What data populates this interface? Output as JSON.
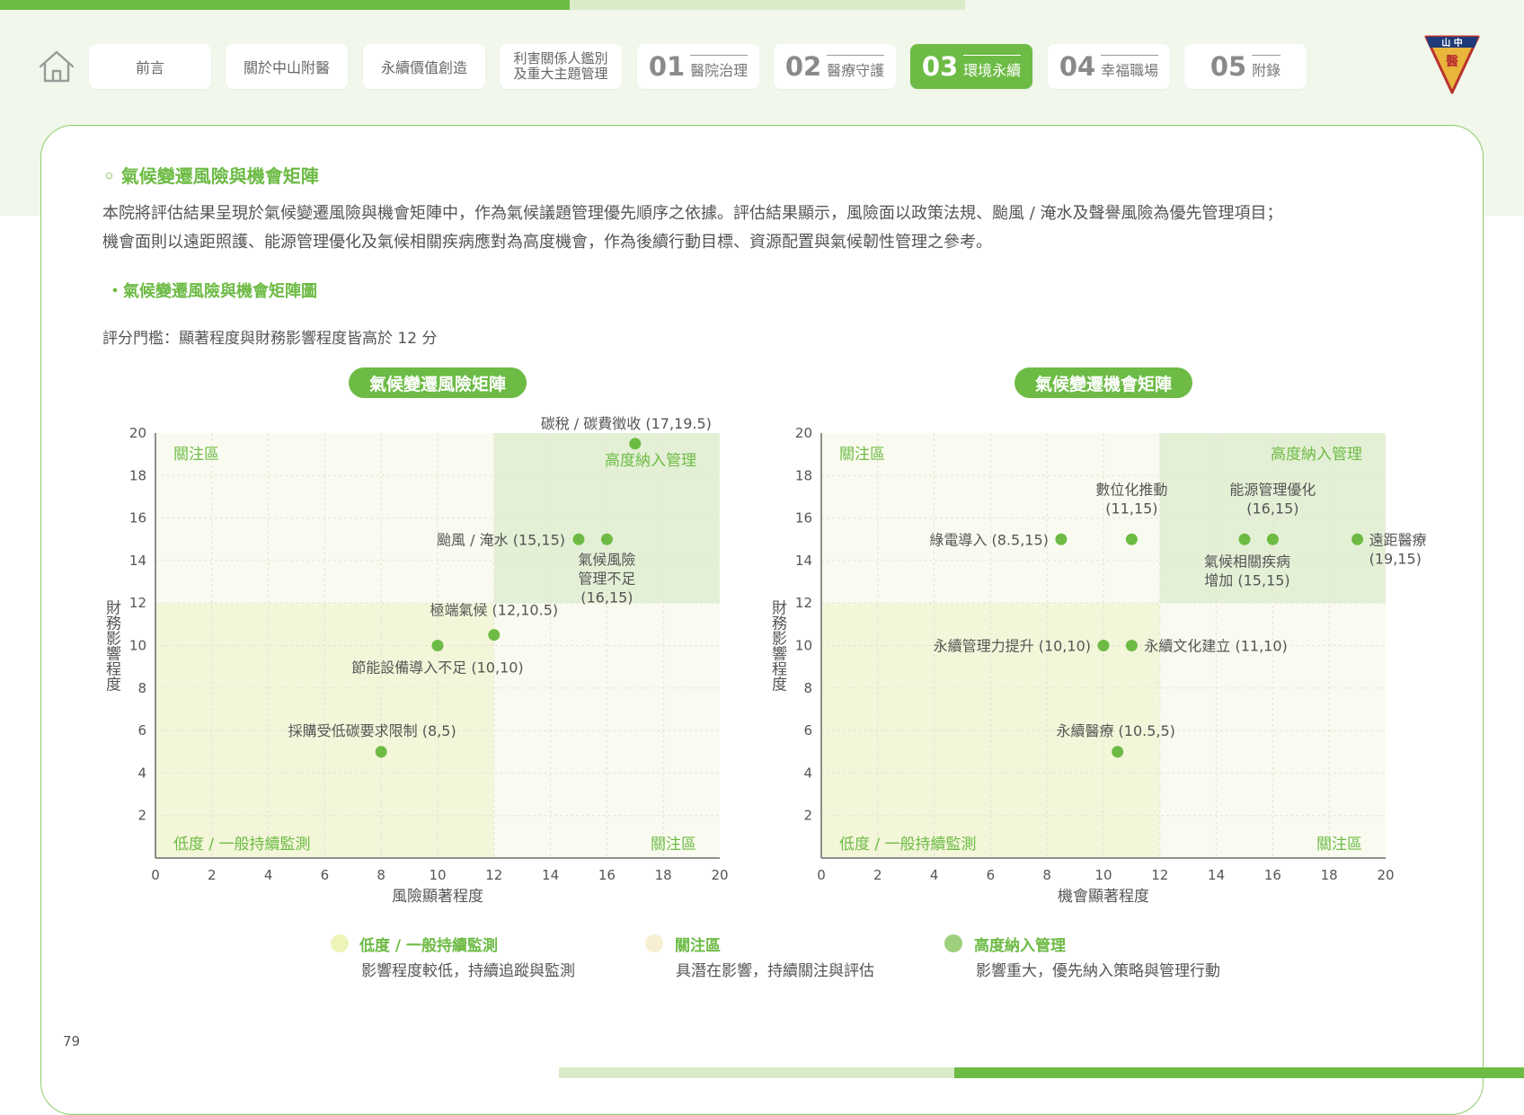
{
  "nav": {
    "home_icon": "home-icon",
    "items": [
      {
        "label": "前言"
      },
      {
        "label": "關於中山附醫"
      },
      {
        "label": "永續價值創造"
      },
      {
        "label_l1": "利害關係人鑑別",
        "label_l2": "及重大主題管理"
      },
      {
        "num": "01",
        "label": "醫院治理"
      },
      {
        "num": "02",
        "label": "醫療守護"
      },
      {
        "num": "03",
        "label": "環境永續",
        "active": true
      },
      {
        "num": "04",
        "label": "幸福職場"
      },
      {
        "num": "05",
        "label": "附錄"
      }
    ],
    "logo_text_top": "山 中",
    "logo_text_mid": "醫"
  },
  "content": {
    "section_title": "◦ 氣候變遷風險與機會矩陣",
    "body_line1": "本院將評估結果呈現於氣候變遷風險與機會矩陣中，作為氣候議題管理優先順序之依據。評估結果顯示，風險面以政策法規、颱風 / 淹水及聲譽風險為優先管理項目；",
    "body_line2": "機會面則以遠距照護、能源管理優化及氣候相關疾病應對為高度機會，作為後續行動目標、資源配置與氣候韌性管理之參考。",
    "sub_title": "・氣候變遷風險與機會矩陣圖",
    "threshold": "評分門檻：顯著程度與財務影響程度皆高於 12 分"
  },
  "colors": {
    "accent": "#6dbb45",
    "low_zone": "#f3f6d9",
    "watch_zone": "#fafbf0",
    "high_zone": "#e4f0d6",
    "legend_low": "#eef3b8",
    "legend_watch": "#f6efd2",
    "legend_high": "#9fd07e",
    "point": "#6dbb45"
  },
  "chart_data": [
    {
      "type": "scatter",
      "title": "氣候變遷風險矩陣",
      "xlabel": "風險顯著程度",
      "ylabel": "財務影響程度",
      "xlim": [
        0,
        20
      ],
      "ylim": [
        0,
        20
      ],
      "xticks": [
        "0",
        "2",
        "4",
        "6",
        "8",
        "10",
        "12",
        "14",
        "16",
        "18",
        "20"
      ],
      "yticks": [
        "2",
        "4",
        "6",
        "8",
        "10",
        "12",
        "14",
        "16",
        "18",
        "20"
      ],
      "threshold": 12,
      "zones": {
        "top_left": "關注區",
        "top_right": "高度納入管理",
        "bottom_left": "低度 / 一般持續監測",
        "bottom_right": "關注區"
      },
      "points": [
        {
          "x": 17,
          "y": 19.5,
          "label": "碳稅 / 碳費徵收 (17,19.5)"
        },
        {
          "x": 15,
          "y": 15,
          "label": "颱風 / 淹水 (15,15)"
        },
        {
          "x": 16,
          "y": 15,
          "label_lines": [
            "氣候風險",
            "管理不足",
            "(16,15)"
          ]
        },
        {
          "x": 12,
          "y": 10.5,
          "label": "極端氣候 (12,10.5)"
        },
        {
          "x": 10,
          "y": 10,
          "label": "節能設備導入不足 (10,10)"
        },
        {
          "x": 8,
          "y": 5,
          "label": "採購受低碳要求限制 (8,5)"
        }
      ]
    },
    {
      "type": "scatter",
      "title": "氣候變遷機會矩陣",
      "xlabel": "機會顯著程度",
      "ylabel": "財務影響程度",
      "xlim": [
        0,
        20
      ],
      "ylim": [
        0,
        20
      ],
      "xticks": [
        "0",
        "2",
        "4",
        "6",
        "8",
        "10",
        "12",
        "14",
        "16",
        "18",
        "20"
      ],
      "yticks": [
        "2",
        "4",
        "6",
        "8",
        "10",
        "12",
        "14",
        "16",
        "18",
        "20"
      ],
      "threshold": 12,
      "zones": {
        "top_left": "關注區",
        "top_right": "高度納入管理",
        "bottom_left": "低度 / 一般持續監測",
        "bottom_right": "關注區"
      },
      "points": [
        {
          "x": 8.5,
          "y": 15,
          "label": "綠電導入 (8.5,15)"
        },
        {
          "x": 11,
          "y": 15,
          "label_lines": [
            "數位化推動",
            "(11,15)"
          ]
        },
        {
          "x": 15,
          "y": 15,
          "label_lines": [
            "氣候相關疾病",
            "增加 (15,15)"
          ]
        },
        {
          "x": 16,
          "y": 15,
          "label_lines": [
            "能源管理優化",
            "(16,15)"
          ]
        },
        {
          "x": 19,
          "y": 15,
          "label_lines": [
            "遠距醫療",
            "(19,15)"
          ]
        },
        {
          "x": 10,
          "y": 10,
          "label": "永續管理力提升 (10,10)"
        },
        {
          "x": 11,
          "y": 10,
          "label": "永續文化建立 (11,10)"
        },
        {
          "x": 10.5,
          "y": 5,
          "label": "永續醫療 (10.5,5)"
        }
      ]
    }
  ],
  "legend": [
    {
      "title": "低度 / 一般持續監測",
      "desc": "影響程度較低，持續追蹤與監測"
    },
    {
      "title": "關注區",
      "desc": "具潛在影響，持續關注與評估"
    },
    {
      "title": "高度納入管理",
      "desc": "影響重大，優先納入策略與管理行動"
    }
  ],
  "page_number": "79"
}
